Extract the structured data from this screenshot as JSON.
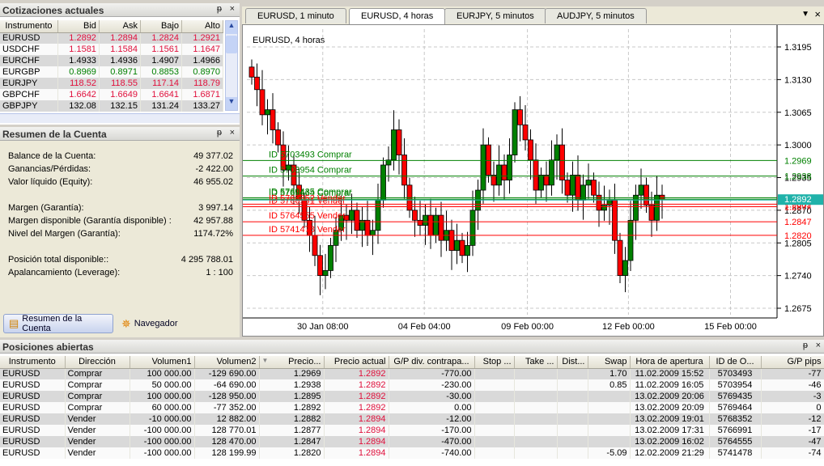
{
  "quotes": {
    "title": "Cotizaciones actuales",
    "columns": [
      "Instrumento",
      "Bid",
      "Ask",
      "Bajo",
      "Alto"
    ],
    "rows": [
      {
        "sym": "EURUSD",
        "bid": "1.2892",
        "ask": "1.2894",
        "low": "1.2824",
        "high": "1.2921",
        "color": "red"
      },
      {
        "sym": "USDCHF",
        "bid": "1.1581",
        "ask": "1.1584",
        "low": "1.1561",
        "high": "1.1647",
        "color": "red"
      },
      {
        "sym": "EURCHF",
        "bid": "1.4933",
        "ask": "1.4936",
        "low": "1.4907",
        "high": "1.4966",
        "color": "black"
      },
      {
        "sym": "EURGBP",
        "bid": "0.8969",
        "ask": "0.8971",
        "low": "0.8853",
        "high": "0.8970",
        "color": "green"
      },
      {
        "sym": "EURJPY",
        "bid": "118.52",
        "ask": "118.55",
        "low": "117.14",
        "high": "118.79",
        "color": "red"
      },
      {
        "sym": "GBPCHF",
        "bid": "1.6642",
        "ask": "1.6649",
        "low": "1.6641",
        "high": "1.6871",
        "color": "red"
      },
      {
        "sym": "GBPJPY",
        "bid": "132.08",
        "ask": "132.15",
        "low": "131.24",
        "high": "133.27",
        "color": "black"
      }
    ]
  },
  "account": {
    "title": "Resumen de la Cuenta",
    "items": [
      {
        "label": "Balance de la Cuenta:",
        "value": "49 377.02"
      },
      {
        "label": "Ganancias/Pérdidas:",
        "value": "-2 422.00"
      },
      {
        "label": "Valor líquido (Equity):",
        "value": "46 955.02"
      },
      {
        "label": "Margen (Garantía):",
        "value": "3 997.14"
      },
      {
        "label": "Margen disponible (Garantía disponible) :",
        "value": "42 957.88"
      },
      {
        "label": "Nivel del Margen (Garantía):",
        "value": "1174.72%"
      },
      {
        "label": "Posición total disponible::",
        "value": "4 295 788.01"
      },
      {
        "label": "Apalancamiento (Leverage):",
        "value": "1 : 100"
      }
    ]
  },
  "bottom_tabs": [
    "Resumen de la Cuenta",
    "Navegador"
  ],
  "chart": {
    "tabs": [
      "EURUSD, 1 minuto",
      "EURUSD, 4 horas",
      "EURJPY, 5 minutos",
      "AUDJPY, 5 minutos"
    ],
    "active_tab": 1,
    "title": "EURUSD, 4 horas",
    "bid": "1.2892",
    "bid_value": 1.2892,
    "price_ticks": [
      "1.3195",
      "1.3130",
      "1.3065",
      "1.3000",
      "1.2935",
      "1.2870",
      "1.2805",
      "1.2740",
      "1.2675"
    ],
    "time_ticks": [
      {
        "label": "30 Jan 08:00",
        "index": 13.5
      },
      {
        "label": "04 Feb 04:00",
        "index": 32.8
      },
      {
        "label": "09 Feb 00:00",
        "index": 52.4
      },
      {
        "label": "12 Feb 00:00",
        "index": 71.6
      },
      {
        "label": "15 Feb 00:00",
        "index": 91
      }
    ],
    "orders": [
      {
        "label": "ID 5703493 Comprar",
        "price": 1.2969,
        "price_label": "1.2969",
        "color": "#008000"
      },
      {
        "label": "ID 5703954 Comprar",
        "price": 1.2938,
        "price_label": "1.2938",
        "color": "#008000"
      },
      {
        "label": "ID 5769435 Comprar",
        "price": 1.2895,
        "price_label": "1.2895",
        "color": "#008000"
      },
      {
        "label": "ID 5769464 Comprar",
        "price": 1.2892,
        "price_label": "1.2892",
        "color": "#008000"
      },
      {
        "label": "ID 5768352 Vender",
        "price": 1.2882,
        "price_label": "1.2882",
        "color": "#ff0000"
      },
      {
        "label": "ID 5766991 Vender",
        "price": 1.2877,
        "price_label": "1.2877",
        "color": "#ff0000"
      },
      {
        "label": "ID 5764555 Vender",
        "price": 1.2847,
        "price_label": "1.2847",
        "color": "#ff0000"
      },
      {
        "label": "ID 5741478 Vender",
        "price": 1.282,
        "price_label": "1.2820",
        "color": "#ff0000"
      }
    ],
    "closes": [
      1.3135,
      1.311,
      1.306,
      1.307,
      1.303,
      1.3,
      1.295,
      1.296,
      1.292,
      1.289,
      1.285,
      1.282,
      1.278,
      1.274,
      1.275,
      1.28,
      1.283,
      1.286,
      1.285,
      1.287,
      1.283,
      1.285,
      1.282,
      1.283,
      1.289,
      1.296,
      1.297,
      1.303,
      1.298,
      1.292,
      1.287,
      1.285,
      1.284,
      1.286,
      1.282,
      1.286,
      1.281,
      1.283,
      1.279,
      1.281,
      1.278,
      1.28,
      1.287,
      1.291,
      1.3,
      1.294,
      1.292,
      1.296,
      1.293,
      1.298,
      1.307,
      1.304,
      1.301,
      1.297,
      1.291,
      1.294,
      1.292,
      1.297,
      1.3,
      1.293,
      1.29,
      1.294,
      1.289,
      1.292,
      1.293,
      1.29,
      1.287,
      1.288,
      1.289,
      1.281,
      1.274,
      1.277,
      1.285,
      1.29,
      1.292,
      1.288,
      1.285,
      1.29,
      1.2892
    ],
    "colors": {
      "up": "#008000",
      "down": "#ff0000",
      "bid": "#20b2aa"
    }
  },
  "positions": {
    "title": "Posiciones abiertas",
    "columns": [
      "Instrumento",
      "Dirección",
      "Volumen1",
      "Volumen2",
      "Precio...",
      "Precio actual",
      "G/P div. contrapa...",
      "Stop ...",
      "Take ...",
      "Dist...",
      "Swap",
      "Hora de apertura",
      "ID de O...",
      "G/P pips"
    ],
    "rows": [
      [
        "EURUSD",
        "Comprar",
        "100 000.00",
        "-129 690.00",
        "1.2969",
        "1.2892",
        "-770.00",
        "",
        "",
        "",
        "1.70",
        "11.02.2009 15:52",
        "5703493",
        "-77"
      ],
      [
        "EURUSD",
        "Comprar",
        "50 000.00",
        "-64 690.00",
        "1.2938",
        "1.2892",
        "-230.00",
        "",
        "",
        "",
        "0.85",
        "11.02.2009 16:05",
        "5703954",
        "-46"
      ],
      [
        "EURUSD",
        "Comprar",
        "100 000.00",
        "-128 950.00",
        "1.2895",
        "1.2892",
        "-30.00",
        "",
        "",
        "",
        "",
        "13.02.2009 20:06",
        "5769435",
        "-3"
      ],
      [
        "EURUSD",
        "Comprar",
        "60 000.00",
        "-77 352.00",
        "1.2892",
        "1.2892",
        "0.00",
        "",
        "",
        "",
        "",
        "13.02.2009 20:09",
        "5769464",
        "0"
      ],
      [
        "EURUSD",
        "Vender",
        "-10 000.00",
        "12 882.00",
        "1.2882",
        "1.2894",
        "-12.00",
        "",
        "",
        "",
        "",
        "13.02.2009 19:01",
        "5768352",
        "-12"
      ],
      [
        "EURUSD",
        "Vender",
        "-100 000.00",
        "128 770.01",
        "1.2877",
        "1.2894",
        "-170.00",
        "",
        "",
        "",
        "",
        "13.02.2009 17:31",
        "5766991",
        "-17"
      ],
      [
        "EURUSD",
        "Vender",
        "-100 000.00",
        "128 470.00",
        "1.2847",
        "1.2894",
        "-470.00",
        "",
        "",
        "",
        "",
        "13.02.2009 16:02",
        "5764555",
        "-47"
      ],
      [
        "EURUSD",
        "Vender",
        "-100 000.00",
        "128 199.99",
        "1.2820",
        "1.2894",
        "-740.00",
        "",
        "",
        "",
        "-5.09",
        "12.02.2009 21:29",
        "5741478",
        "-74"
      ]
    ]
  },
  "icons": {
    "pin": "📌",
    "close": "×",
    "menu": "▼"
  }
}
